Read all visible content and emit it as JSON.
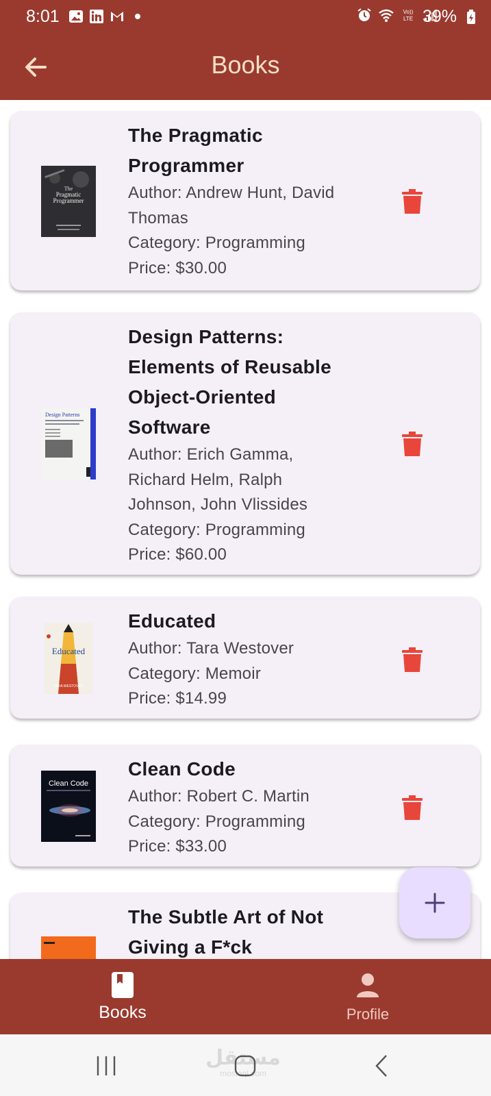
{
  "status_bar": {
    "time": "8:01",
    "battery": "39%",
    "left_icons": [
      "gallery-icon",
      "linkedin-icon",
      "gmail-icon",
      "dot-icon"
    ],
    "right_icons": [
      "alarm-icon",
      "wifi-icon",
      "volte-icon",
      "signal-icon",
      "battery-icon"
    ]
  },
  "app_bar": {
    "title": "Books",
    "back_icon": "arrow-left-icon"
  },
  "books": [
    {
      "title_lines": [
        "The Pragmatic",
        "Programmer"
      ],
      "author_lines": [
        "Author: Andrew Hunt, David",
        "Thomas"
      ],
      "category": "Category: Programming",
      "price": "Price: $30.00",
      "cover_icon": "pragmatic-programmer-cover",
      "cover_text_1": "The",
      "cover_text_2": "Pragmatic",
      "cover_text_3": "Programmer"
    },
    {
      "title_lines": [
        "Design Patterns:",
        "Elements of Reusable",
        "Object-Oriented",
        "Software"
      ],
      "author_lines": [
        "Author: Erich Gamma,",
        "Richard Helm, Ralph",
        "Johnson, John Vlissides"
      ],
      "category": "Category: Programming",
      "price": "Price: $60.00",
      "cover_icon": "design-patterns-cover",
      "cover_text_1": "Design Patterns"
    },
    {
      "title_lines": [
        "Educated"
      ],
      "author_lines": [
        "Author: Tara Westover"
      ],
      "category": "Category: Memoir",
      "price": "Price: $14.99",
      "cover_icon": "educated-cover",
      "cover_text_1": "Educated",
      "cover_text_2": "TARA WESTOVER"
    },
    {
      "title_lines": [
        "Clean Code"
      ],
      "author_lines": [
        "Author: Robert C. Martin"
      ],
      "category": "Category: Programming",
      "price": "Price: $33.00",
      "cover_icon": "clean-code-cover",
      "cover_text_1": "Clean Code"
    },
    {
      "title_lines": [
        "The Subtle Art of Not",
        "Giving a F*ck"
      ],
      "cover_icon": "subtle-art-cover"
    }
  ],
  "delete_icon": "trash-icon",
  "fab": {
    "icon": "plus-icon"
  },
  "bottom_nav": {
    "items": [
      {
        "label": "Books",
        "icon": "book-icon",
        "selected": true
      },
      {
        "label": "Profile",
        "icon": "person-icon",
        "selected": false
      }
    ]
  },
  "system_nav": {
    "buttons": [
      "recents-icon",
      "home-icon",
      "back-icon"
    ],
    "watermark": "مستقل",
    "watermark_sub": "mostaql.com"
  },
  "colors": {
    "primary": "#9a3a2f",
    "app_bar_title": "#f6dfc6",
    "card_bg": "#f5eff7",
    "delete": "#e8463a",
    "fab_bg": "#e9ddff",
    "fab_icon": "#4a3f78"
  }
}
